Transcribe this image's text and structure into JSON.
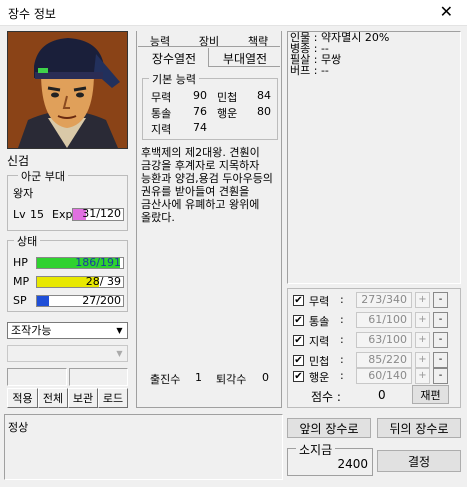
{
  "window": {
    "title": "장수 정보",
    "close": "✕"
  },
  "general": {
    "name": "신검",
    "unit_label": "아군 부대",
    "rank": "왕자",
    "level_label": "Lv",
    "level": "15",
    "exp_label": "Exp",
    "exp_value": "31/120",
    "exp_fraction": 0.26
  },
  "status": {
    "label": "상태",
    "hp": {
      "label": "HP",
      "value": "186/191",
      "fraction": 0.97,
      "color": "#2fd22f"
    },
    "mp": {
      "label": "MP",
      "value": "28/ 39",
      "fraction": 0.72,
      "color": "#e8e800"
    },
    "sp": {
      "label": "SP",
      "value": "27/200",
      "fraction": 0.135,
      "color": "#1f4fd8"
    }
  },
  "control": {
    "selected": "조작가능",
    "second": ""
  },
  "action_buttons": [
    "적용",
    "전체",
    "보관",
    "로드"
  ],
  "tabs": {
    "row1": [
      "능력",
      "장비",
      "책략"
    ],
    "row2": [
      "장수열전",
      "부대열전"
    ]
  },
  "basic_ability": {
    "label": "기본 능력",
    "rows": [
      {
        "k1": "무력",
        "v1": "90",
        "k2": "민첩",
        "v2": "84"
      },
      {
        "k1": "통솔",
        "v1": "76",
        "k2": "행운",
        "v2": "80"
      },
      {
        "k1": "지력",
        "v1": "74",
        "k2": "",
        "v2": ""
      }
    ]
  },
  "biography": "후백제의 제2대왕. 견훤이 금강을 후계자로 지목하자 능환과 양검,용검 두아우등의 권유를 받아들여 견훤을 금산사에 유폐하고 왕위에 올랐다.",
  "battle": {
    "sorties_label": "출진수",
    "sorties": "1",
    "retreats_label": "퇴각수",
    "retreats": "0"
  },
  "traits": {
    "lines": [
      "인물 : 약자멸시 20%",
      "병종 : --",
      "필살 : 무쌍",
      "버프 : --"
    ]
  },
  "alloc": {
    "rows": [
      {
        "label": "무력",
        "value": "273/340"
      },
      {
        "label": "통솔",
        "value": "61/100"
      },
      {
        "label": "지력",
        "value": "63/100"
      },
      {
        "label": "민첩",
        "value": "85/220"
      },
      {
        "label": "행운",
        "value": "60/140"
      }
    ],
    "plus": "+",
    "minus": "-",
    "points_label": "점수 :",
    "points": "0",
    "reroll": "재편"
  },
  "bottom": {
    "status_text": "정상",
    "prev_btn": "앞의 장수로",
    "next_btn": "뒤의 장수로",
    "gold_label": "소지금",
    "gold": "2400",
    "decide_btn": "결정"
  }
}
